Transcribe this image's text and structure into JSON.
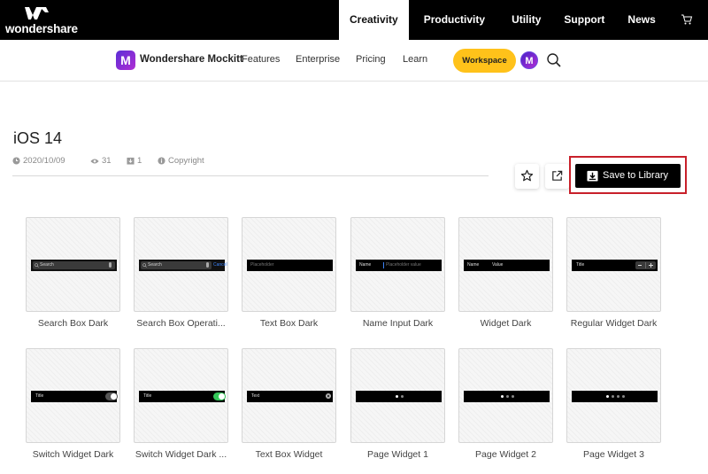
{
  "topbar": {
    "logo_text": "wondershare",
    "nav": [
      "Creativity",
      "Productivity",
      "Utility",
      "Support",
      "News"
    ],
    "active": "Creativity"
  },
  "subnav": {
    "brand": "Wondershare Mockitt",
    "links": [
      "Features",
      "Enterprise",
      "Pricing",
      "Learn"
    ],
    "workspace_label": "Workspace",
    "avatar_letter": "M"
  },
  "page": {
    "title": "iOS 14",
    "date": "2020/10/09",
    "views": "31",
    "count": "1",
    "license": "Copyright",
    "save_label": "Save to Library"
  },
  "colors": {
    "accent": "#ffc21a",
    "brand": "#7b2fd4",
    "highlight": "#c8202a"
  },
  "cards": [
    {
      "label": "Search Box Dark",
      "text": "Search"
    },
    {
      "label": "Search Box Operati...",
      "text": "Search",
      "action": "Cancel"
    },
    {
      "label": "Text Box Dark",
      "text": "Placeholder"
    },
    {
      "label": "Name Input Dark",
      "text": "Name",
      "value": "Placeholder value"
    },
    {
      "label": "Widget Dark",
      "text": "Name",
      "value": "Value"
    },
    {
      "label": "Regular Widget Dark",
      "text": "Title"
    },
    {
      "label": "Switch Widget Dark",
      "text": "Title"
    },
    {
      "label": "Switch Widget Dark ...",
      "text": "Title"
    },
    {
      "label": "Text Box Widget",
      "text": "Text"
    },
    {
      "label": "Page Widget 1",
      "dots": 2
    },
    {
      "label": "Page Widget 2",
      "dots": 3
    },
    {
      "label": "Page Widget 3",
      "dots": 4
    }
  ]
}
